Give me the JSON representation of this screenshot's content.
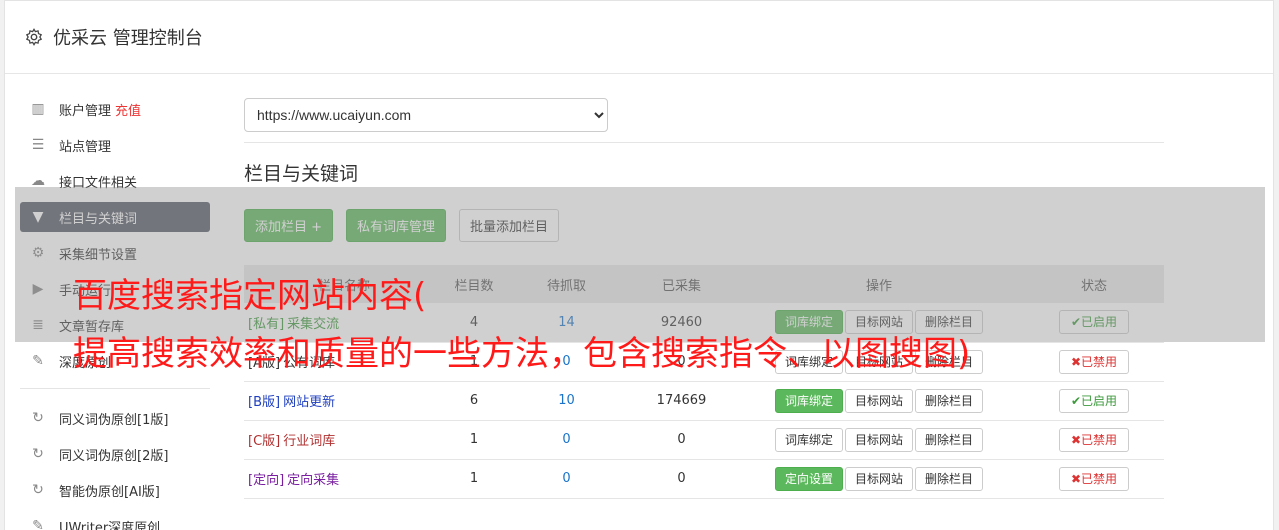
{
  "header": {
    "title": "优采云 管理控制台",
    "icon": "gear-icon"
  },
  "sidebar": {
    "items": [
      {
        "label": "账户管理",
        "extra": "充值",
        "icon": "bar-chart-icon",
        "icon_glyph": "▥"
      },
      {
        "label": "站点管理",
        "icon": "server-icon",
        "icon_glyph": "☰"
      },
      {
        "label": "接口文件相关",
        "icon": "cloud-upload-icon",
        "icon_glyph": "☁"
      },
      {
        "label": "栏目与关键词",
        "icon": "filter-icon",
        "icon_glyph": "▼",
        "active": true
      },
      {
        "label": "采集细节设置",
        "icon": "cogs-icon",
        "icon_glyph": "⚙"
      },
      {
        "label": "手动运行",
        "icon": "play-circle-icon",
        "icon_glyph": "▶"
      },
      {
        "label": "文章暂存库",
        "icon": "database-icon",
        "icon_glyph": "≣"
      },
      {
        "label": "深度原创",
        "icon": "edit-icon",
        "icon_glyph": "✎"
      }
    ],
    "items2": [
      {
        "label": "同义词伪原创[1版]",
        "icon": "refresh-icon",
        "icon_glyph": "↻"
      },
      {
        "label": "同义词伪原创[2版]",
        "icon": "refresh-icon",
        "icon_glyph": "↻"
      },
      {
        "label": "智能伪原创[AI版]",
        "icon": "refresh-icon",
        "icon_glyph": "↻"
      },
      {
        "label": "UWriter深度原创",
        "icon": "edit-icon",
        "icon_glyph": "✎"
      }
    ]
  },
  "main": {
    "site_select": {
      "value": "https://www.ucaiyun.com"
    },
    "section_title": "栏目与关键词",
    "buttons": {
      "add_column": "添加栏目 +",
      "private_lib": "私有词库管理",
      "batch_add": "批量添加栏目"
    },
    "table": {
      "headers": [
        "栏目名称",
        "栏目数",
        "待抓取",
        "已采集",
        "操作",
        "状态"
      ],
      "rows": [
        {
          "tag": "[私有]",
          "name": "采集交流",
          "color": "#3c9a3c",
          "count": "4",
          "pending": "14",
          "collected": "92460",
          "op1": "词库绑定",
          "op1_green": true,
          "op2": "目标网站",
          "op3": "删除栏目",
          "status": "✔已启用",
          "status_on": true
        },
        {
          "tag": "[A版]",
          "name": "公有词库",
          "color": "#333333",
          "count": "1",
          "pending": "0",
          "collected": "0",
          "op1": "词库绑定",
          "op1_green": false,
          "op2": "目标网站",
          "op3": "删除栏目",
          "status": "✖已禁用",
          "status_on": false
        },
        {
          "tag": "[B版]",
          "name": "网站更新",
          "color": "#1f3fbf",
          "count": "6",
          "pending": "10",
          "collected": "174669",
          "op1": "词库绑定",
          "op1_green": true,
          "op2": "目标网站",
          "op3": "删除栏目",
          "status": "✔已启用",
          "status_on": true
        },
        {
          "tag": "[C版]",
          "name": "行业词库",
          "color": "#b03030",
          "count": "1",
          "pending": "0",
          "collected": "0",
          "op1": "词库绑定",
          "op1_green": false,
          "op2": "目标网站",
          "op3": "删除栏目",
          "status": "✖已禁用",
          "status_on": false
        },
        {
          "tag": "[定向]",
          "name": "定向采集",
          "color": "#7a1fa0",
          "count": "1",
          "pending": "0",
          "collected": "0",
          "op1": "定向设置",
          "op1_green": true,
          "op2": "目标网站",
          "op3": "删除栏目",
          "status": "✖已禁用",
          "status_on": false
        }
      ]
    }
  },
  "overlay": {
    "line1": "百度搜索指定网站内容(",
    "line2": "提高搜索效率和质量的一些方法，包含搜索指令、以图搜图)"
  }
}
